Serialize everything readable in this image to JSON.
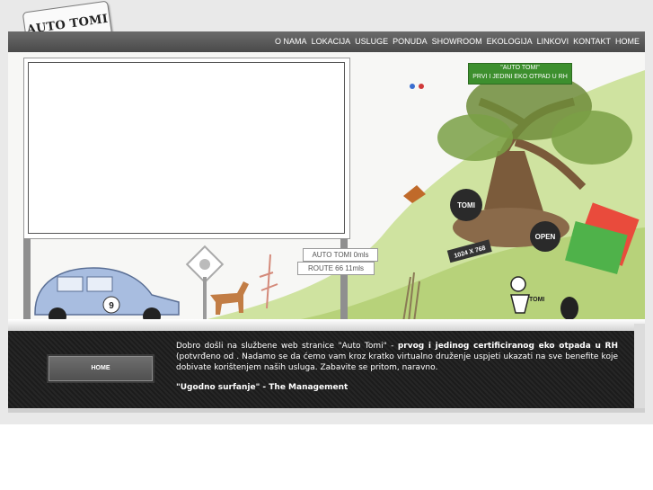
{
  "logo": {
    "text": "AUTO TOMI"
  },
  "nav": {
    "items": [
      "O NAMA",
      "LOKACIJA",
      "USLUGE",
      "PONUDA",
      "SHOWROOM",
      "EKOLOGIJA",
      "LINKOVI",
      "KONTAKT",
      "HOME"
    ]
  },
  "scene": {
    "green_sign_title": "\"AUTO TOMI\"",
    "green_sign_sub": "PRVI I JEDINI EKO OTPAD U RH",
    "road_sign_1": "AUTO TOMI 0mls",
    "road_sign_2": "ROUTE 66 11mls",
    "tomi_badge": "TOMI",
    "open_badge": "OPEN",
    "resolution_plate": "1024 X 768",
    "car_number": "9",
    "mascot_label": "TOMI"
  },
  "footer": {
    "home_button": "HOME",
    "welcome_pre": "Dobro došli na službene web stranice \"Auto Tomi\" - ",
    "welcome_bold": "prvog i jedinog certificiranog eko otpada u RH",
    "welcome_post": " (potvrđeno od . Nadamo se da ćemo vam kroz kratko virtualno druženje uspjeti ukazati na sve benefite koje dobivate korištenjem naših usluga. Zabavite se pritom, naravno.",
    "signoff": "\"Ugodno surfanje\" - The Management"
  },
  "colors": {
    "nav_bg": "#555555",
    "sign_green": "#3d8f2e",
    "grass": "#bcd77a",
    "car_blue": "#9cb4d8",
    "footer_bg": "#1f1f1f"
  }
}
